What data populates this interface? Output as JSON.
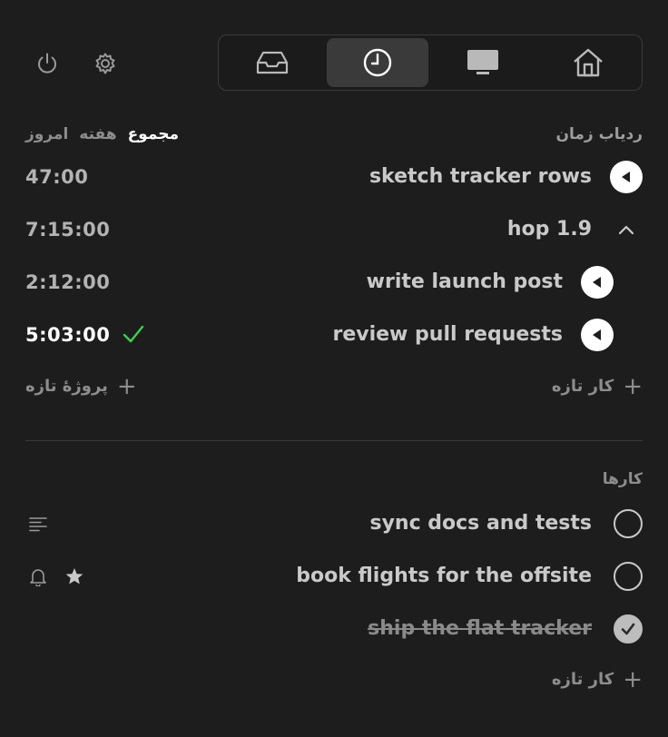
{
  "topbar": {
    "power_icon": "power-icon",
    "settings_icon": "gear-icon",
    "tabs": [
      {
        "icon": "inbox-icon",
        "active": false
      },
      {
        "icon": "clock-icon",
        "active": true
      },
      {
        "icon": "monitor-icon",
        "active": false
      },
      {
        "icon": "home-icon",
        "active": false
      }
    ]
  },
  "tracker": {
    "title": "ردیاب زمان",
    "ranges": [
      {
        "label": "مجموع",
        "selected": true
      },
      {
        "label": "هفته",
        "selected": false
      },
      {
        "label": "امروز",
        "selected": false
      }
    ],
    "rows": [
      {
        "name": "sketch tracker rows",
        "time": "47:00",
        "control": "play"
      },
      {
        "name": "hop 1.9",
        "time": "7:15:00",
        "control": "collapse"
      },
      {
        "name": "write launch post",
        "time": "2:12:00",
        "control": "play"
      },
      {
        "name": "review pull requests",
        "time": "5:03:00",
        "control": "play",
        "completed": true
      }
    ],
    "new_task_label": "کار تازه",
    "new_project_label": "پروژهٔ تازه"
  },
  "tasks": {
    "title": "کارها",
    "items": [
      {
        "name": "sync docs and tests",
        "done": false,
        "icons": [
          "notes-icon"
        ]
      },
      {
        "name": "book flights for the offsite",
        "done": false,
        "icons": [
          "bell-icon",
          "star-icon"
        ]
      },
      {
        "name": "ship the flat tracker",
        "done": true,
        "icons": []
      }
    ],
    "new_task_label": "کار تازه"
  },
  "colors": {
    "background": "#1d1d1e",
    "accent_check": "#3ccf4e",
    "active_tab": "#3a3a3b"
  }
}
